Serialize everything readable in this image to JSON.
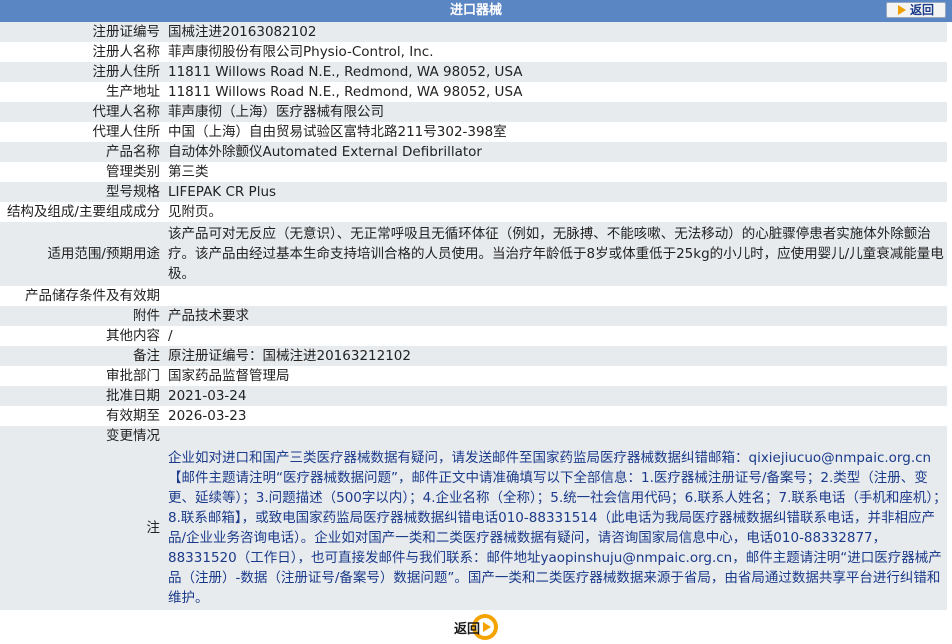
{
  "header": {
    "title": "进口器械",
    "back_label": "返回"
  },
  "rows": [
    {
      "label": "注册证编号",
      "value": "国械注进20163082102"
    },
    {
      "label": "注册人名称",
      "value": "菲声康彻股份有限公司Physio-Control, Inc."
    },
    {
      "label": "注册人住所",
      "value": "11811 Willows Road N.E., Redmond, WA 98052, USA"
    },
    {
      "label": "生产地址",
      "value": "11811 Willows Road N.E., Redmond, WA 98052, USA"
    },
    {
      "label": "代理人名称",
      "value": "菲声康彻（上海）医疗器械有限公司"
    },
    {
      "label": "代理人住所",
      "value": "中国（上海）自由贸易试验区富特北路211号302-398室"
    },
    {
      "label": "产品名称",
      "value": "自动体外除颤仪Automated External Defibrillator"
    },
    {
      "label": "管理类别",
      "value": "第三类"
    },
    {
      "label": "型号规格",
      "value": "LIFEPAK CR Plus"
    },
    {
      "label": "结构及组成/主要组成成分",
      "value": "见附页。"
    },
    {
      "label": "适用范围/预期用途",
      "value": "该产品可对无反应（无意识）、无正常呼吸且无循环体征（例如，无脉搏、不能咳嗽、无法移动）的心脏骤停患者实施体外除颤治疗。该产品由经过基本生命支持培训合格的人员使用。当治疗年龄低于8岁或体重低于25kg的小儿时，应使用婴儿/儿童衰减能量电极。"
    },
    {
      "label": "产品储存条件及有效期",
      "value": ""
    },
    {
      "label": "附件",
      "value": "产品技术要求"
    },
    {
      "label": "其他内容",
      "value": "/"
    },
    {
      "label": "备注",
      "value": "原注册证编号：国械注进20163212102"
    },
    {
      "label": "审批部门",
      "value": "国家药品监督管理局"
    },
    {
      "label": "批准日期",
      "value": "2021-03-24"
    },
    {
      "label": "有效期至",
      "value": "2026-03-23"
    },
    {
      "label": "变更情况",
      "value": ""
    }
  ],
  "note": {
    "label": "注",
    "text": "企业如对进口和国产三类医疗器械数据有疑问，请发送邮件至国家药监局医疗器械数据纠错邮箱：qixiejiucuo@nmpaic.org.cn【邮件主题请注明“医疗器械数据问题”，邮件正文中请准确填写以下全部信息：1.医疗器械注册证号/备案号；2.类型（注册、变更、延续等）；3.问题描述（500字以内）；4.企业名称（全称）；5.统一社会信用代码；6.联系人姓名；7.联系电话（手机和座机）；8.联系邮箱】，或致电国家药监局医疗器械数据纠错电话010-88331514（此电话为我局医疗器械数据纠错联系电话，并非相应产品/企业业务咨询电话）。企业如对国产一类和二类医疗器械数据有疑问，请咨询国家局信息中心，电话010-88332877，88331520（工作日），也可直接发邮件与我们联系：邮件地址yaopinshuju@nmpaic.org.cn，邮件主题请注明“进口医疗器械产品（注册）-数据（注册证号/备案号）数据问题”。国产一类和二类医疗器械数据来源于省局，由省局通过数据共享平台进行纠错和维护。"
  },
  "footer": {
    "back_label": "返回"
  },
  "colors": {
    "header_bg": "#5b86c4",
    "row_alt_bg": "#e8ebee",
    "accent_orange": "#f5a300",
    "text_blue": "#1a3a8a"
  },
  "icons": {
    "back_top": "arrow-right-icon",
    "back_bottom": "circle-arrow-icon"
  }
}
